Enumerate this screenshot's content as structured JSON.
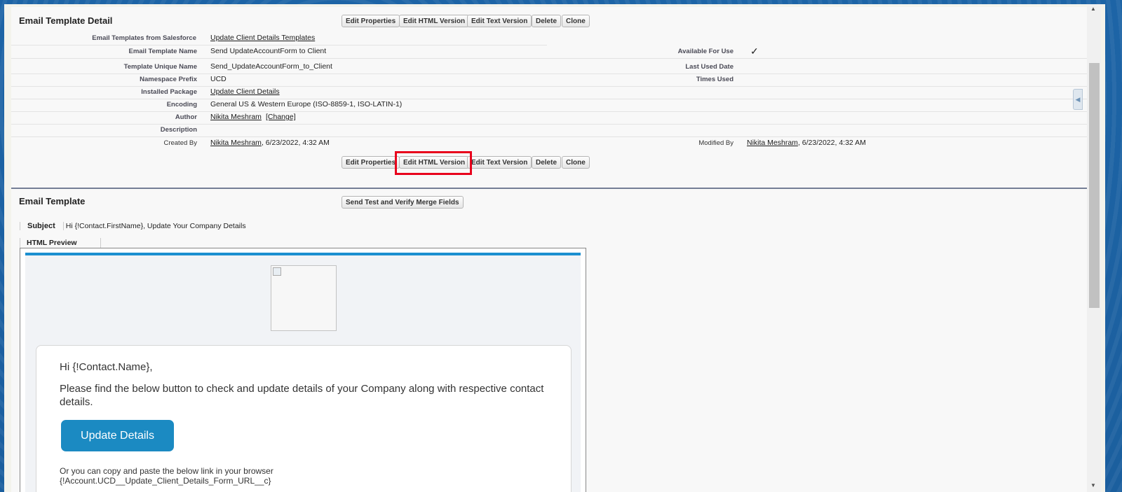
{
  "detail": {
    "title": "Email Template Detail",
    "buttons": {
      "edit_properties": "Edit Properties",
      "edit_html": "Edit HTML Version",
      "edit_text": "Edit Text Version",
      "delete": "Delete",
      "clone": "Clone"
    },
    "fields": {
      "folder_label": "Email Templates from Salesforce",
      "folder_value": "Update Client Details Templates",
      "name_label": "Email Template Name",
      "name_value": "Send UpdateAccountForm to Client",
      "available_label": "Available For Use",
      "available_value": "✓",
      "unique_label": "Template Unique Name",
      "unique_value": "Send_UpdateAccountForm_to_Client",
      "last_used_label": "Last Used Date",
      "namespace_label": "Namespace Prefix",
      "namespace_value": "UCD",
      "times_used_label": "Times Used",
      "package_label": "Installed Package",
      "package_value": "Update Client Details",
      "encoding_label": "Encoding",
      "encoding_value": "General US & Western Europe (ISO-8859-1, ISO-LATIN-1)",
      "author_label": "Author",
      "author_name": "Nikita Meshram",
      "author_change": "[Change]",
      "description_label": "Description",
      "created_label": "Created By",
      "created_name": "Nikita Meshram",
      "created_date": ", 6/23/2022, 4:32 AM",
      "modified_label": "Modified By",
      "modified_name": "Nikita Meshram",
      "modified_date": ", 6/23/2022, 4:32 AM"
    }
  },
  "template": {
    "title": "Email Template",
    "send_test_button": "Send Test and Verify Merge Fields",
    "subject_label": "Subject",
    "subject_value": "Hi {!Contact.FirstName}, Update Your Company Details",
    "preview_tab": "HTML Preview",
    "email": {
      "greeting": "Hi {!Contact.Name},",
      "body": "Please find the below button to check and update details of your Company along with respective contact details.",
      "cta": "Update Details",
      "copy_text": "Or you can copy and paste the below link in your browser",
      "link_text": "{!Account.UCD__Update_Client_Details_Form_URL__c}"
    }
  },
  "colors": {
    "highlight": "#e8001c",
    "cta": "#1b8ac2",
    "preview_bar": "#1b8fd0"
  },
  "icons": {
    "side_handle": "collapse-arrow-icon",
    "scroll_up": "scroll-up-arrow-icon",
    "scroll_down": "scroll-down-arrow-icon"
  }
}
